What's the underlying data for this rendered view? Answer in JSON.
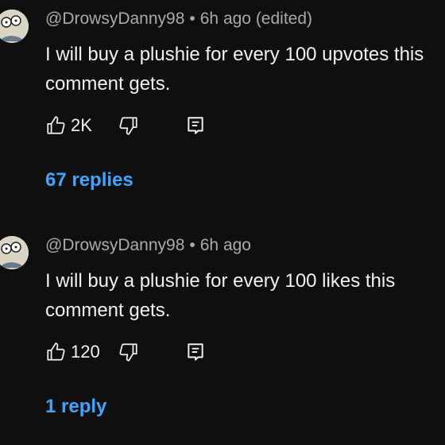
{
  "comments": [
    {
      "author": "@DrowsyDanny98",
      "separator": "•",
      "time": "6h ago (edited)",
      "text_line1": "I will buy a plushie for every 100 upvotes this",
      "text_line2": "comment gets.",
      "likes": "2K",
      "replies_label": "67 replies"
    },
    {
      "author": "@DrowsyDanny98",
      "separator": "•",
      "time": "6h ago",
      "text_line1": "I will buy a plushie for every 100 likes this",
      "text_line2": "comment gets.",
      "likes": "120",
      "replies_label": "1 reply"
    }
  ],
  "colors": {
    "background": "#0f0f0f",
    "text": "#f1f1f1",
    "meta": "#aaaaaa",
    "link": "#3ea6ff"
  },
  "icons": {
    "like": "thumb-up-icon",
    "dislike": "thumb-down-icon",
    "reply": "reply-comment-icon"
  }
}
